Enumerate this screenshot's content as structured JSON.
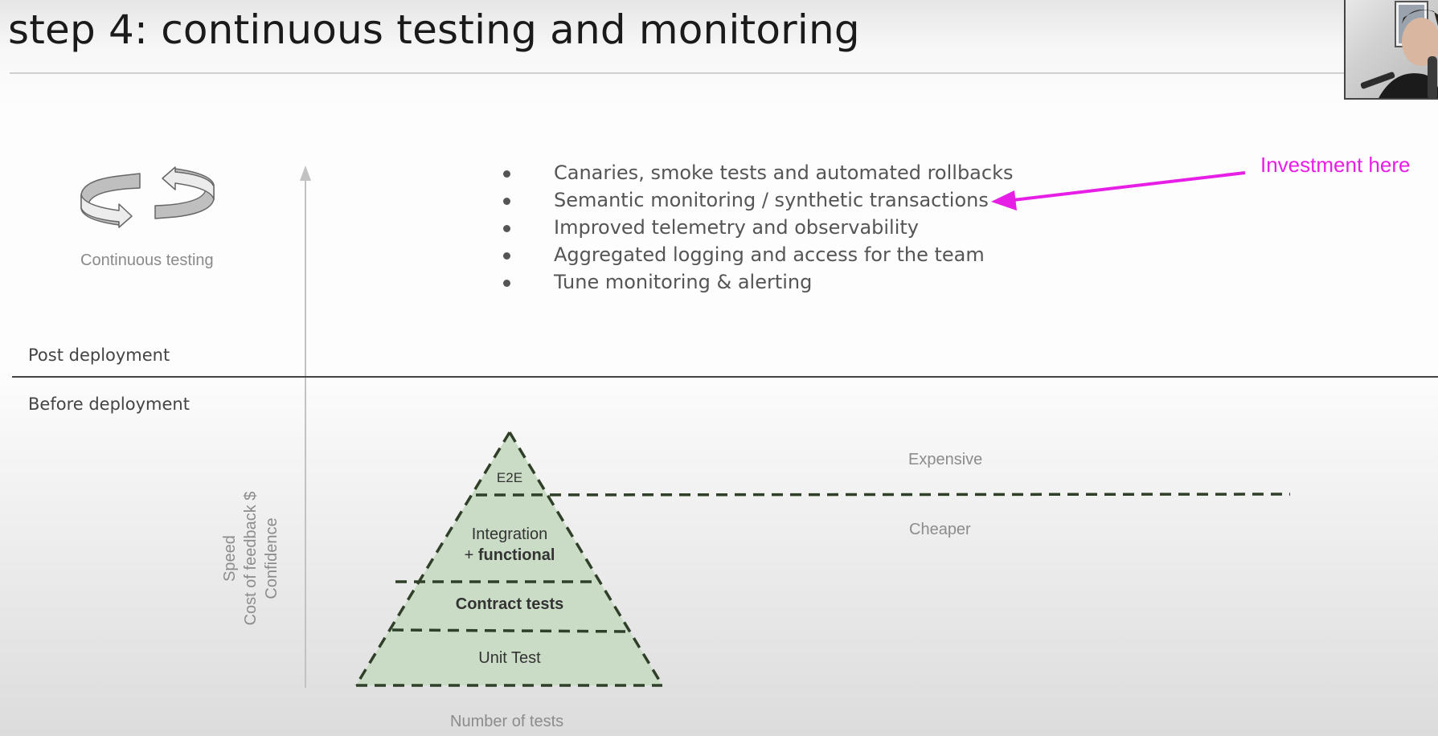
{
  "slide": {
    "title": "step 4: continuous testing and monitoring"
  },
  "cycle": {
    "label": "Continuous testing",
    "icon": "rotate-cycle-icon"
  },
  "post_deployment": {
    "items": [
      "Canaries, smoke tests and automated rollbacks",
      "Semantic monitoring / synthetic transactions",
      "Improved telemetry and observability",
      "Aggregated logging and access for the team",
      "Tune monitoring & alerting"
    ],
    "callout": "Investment here",
    "callout_color": "#e61ee6"
  },
  "phases": {
    "post": "Post deployment",
    "before": "Before deployment"
  },
  "pyramid": {
    "fill_color": "#cbdcc6",
    "line_color": "#2f3f28",
    "tiers": {
      "e2e": "E2E",
      "integration_line1": "Integration",
      "integration_prefix": "+ ",
      "integration_bold": "functional",
      "contract": "Contract tests",
      "unit": "Unit Test"
    },
    "expensive_label": "Expensive",
    "cheaper_label": "Cheaper",
    "y_axis_labels": [
      "Speed",
      "Cost of feedback $",
      "Confidence"
    ],
    "x_axis_label": "Number of tests"
  }
}
